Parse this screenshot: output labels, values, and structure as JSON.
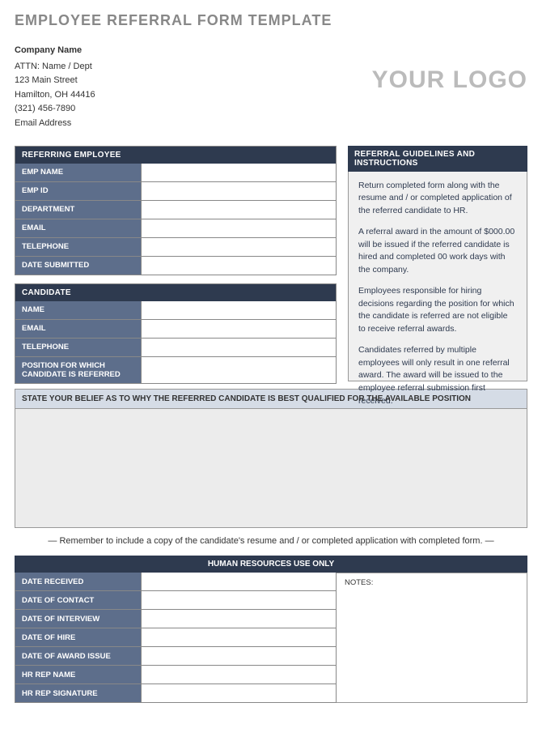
{
  "title": "EMPLOYEE REFERRAL FORM TEMPLATE",
  "company": {
    "name": "Company Name",
    "attn": "ATTN: Name / Dept",
    "address1": "123 Main Street",
    "address2": "Hamilton, OH  44416",
    "phone": "(321) 456-7890",
    "email": "Email Address"
  },
  "logo": "YOUR LOGO",
  "sections": {
    "referring": {
      "header": "REFERRING EMPLOYEE",
      "fields": [
        "EMP NAME",
        "EMP ID",
        "DEPARTMENT",
        "EMAIL",
        "TELEPHONE",
        "DATE SUBMITTED"
      ]
    },
    "candidate": {
      "header": "CANDIDATE",
      "fields": [
        "NAME",
        "EMAIL",
        "TELEPHONE",
        "POSITION FOR WHICH CANDIDATE IS REFERRED"
      ]
    },
    "guidelines": {
      "header": "REFERRAL GUIDELINES AND INSTRUCTIONS",
      "p1": "Return completed form along with the resume and / or completed application of the referred candidate to HR.",
      "p2": "A referral award in the amount of $000.00 will be issued if the referred candidate is hired and completed 00 work days with the company.",
      "p3": "Employees responsible for hiring decisions regarding the position for which the candidate is referred are not eligible to receive referral awards.",
      "p4": "Candidates referred by multiple employees will only result in one referral award.  The award will be issued to the employee referral submission first received."
    },
    "belief": {
      "header": "STATE YOUR BELIEF AS TO WHY THE REFERRED CANDIDATE IS BEST QUALIFIED FOR THE AVAILABLE POSITION"
    },
    "reminder": "— Remember to include a copy of the candidate's resume and / or completed application with completed form. —",
    "hr": {
      "header": "HUMAN RESOURCES USE ONLY",
      "fields": [
        "DATE RECEIVED",
        "DATE OF CONTACT",
        "DATE OF INTERVIEW",
        "DATE OF HIRE",
        "DATE OF AWARD ISSUE",
        "HR REP NAME",
        "HR REP SIGNATURE"
      ],
      "notes": "NOTES:"
    }
  }
}
